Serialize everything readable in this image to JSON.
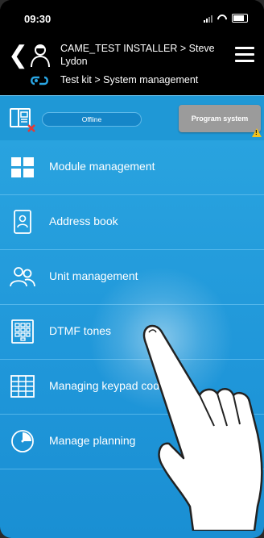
{
  "status_bar": {
    "time": "09:30"
  },
  "header": {
    "user_path": "CAME_TEST INSTALLER > Steve Lydon",
    "kit_path": "Test kit > System management"
  },
  "system_bar": {
    "status": "Offline",
    "program_button": "Program system"
  },
  "menu_items": [
    {
      "label": "Module management",
      "icon": "module-grid-icon"
    },
    {
      "label": "Address book",
      "icon": "address-book-icon"
    },
    {
      "label": "Unit management",
      "icon": "users-icon"
    },
    {
      "label": "DTMF tones",
      "icon": "keypad-icon"
    },
    {
      "label": "Managing keypad cod",
      "icon": "keypad-codes-icon"
    },
    {
      "label": "Manage planning",
      "icon": "clock-icon"
    }
  ],
  "colors": {
    "background_top": "#29a3df",
    "header": "#000000",
    "program_button": "#9b9b9b",
    "warning": "#f3c11b",
    "error_x": "#e53935"
  }
}
